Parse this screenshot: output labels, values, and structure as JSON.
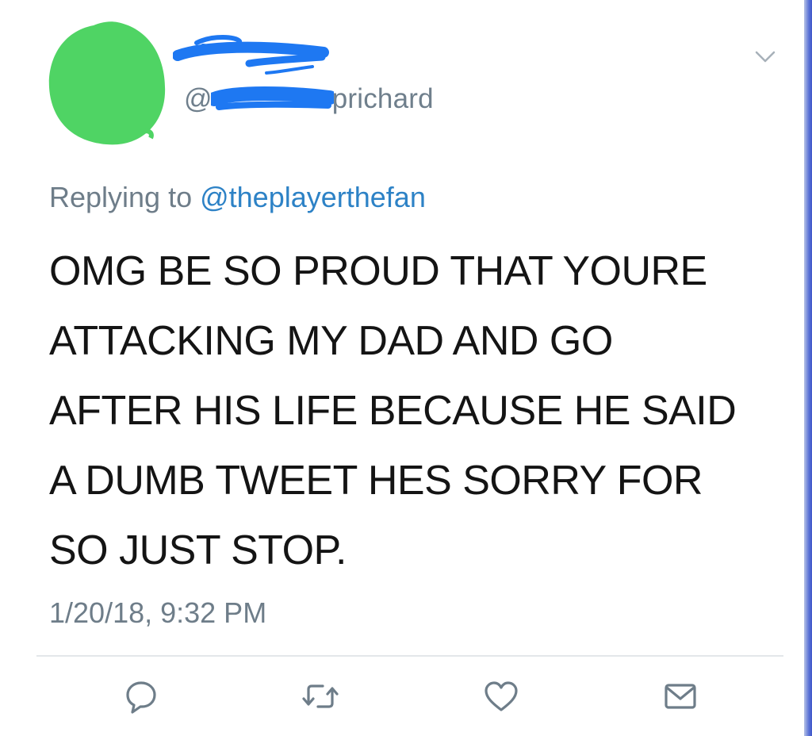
{
  "tweet": {
    "handle_prefix": "@",
    "handle_visible_suffix": "prichard",
    "replying_prefix": "Replying to ",
    "replying_mention": "@theplayerthefan",
    "body_lines": [
      "OMG BE SO PROUD THAT YOURE",
      "ATTACKING MY DAD AND GO",
      "AFTER HIS LIFE BECAUSE HE SAID",
      "A DUMB TWEET HES SORRY FOR",
      "SO JUST STOP."
    ],
    "timestamp": "1/20/18, 9:32 PM"
  },
  "actions": {
    "reply_icon": "reply-icon",
    "retweet_icon": "retweet-icon",
    "like_icon": "heart-icon",
    "dm_icon": "envelope-icon"
  },
  "colors": {
    "avatar_redaction": "#4fd464",
    "handle_redaction": "#1e78f2",
    "mention_link": "#2d82c6",
    "secondary_text": "#6e7d89",
    "body_text": "#141414",
    "icon_gray": "#6e7d89"
  }
}
